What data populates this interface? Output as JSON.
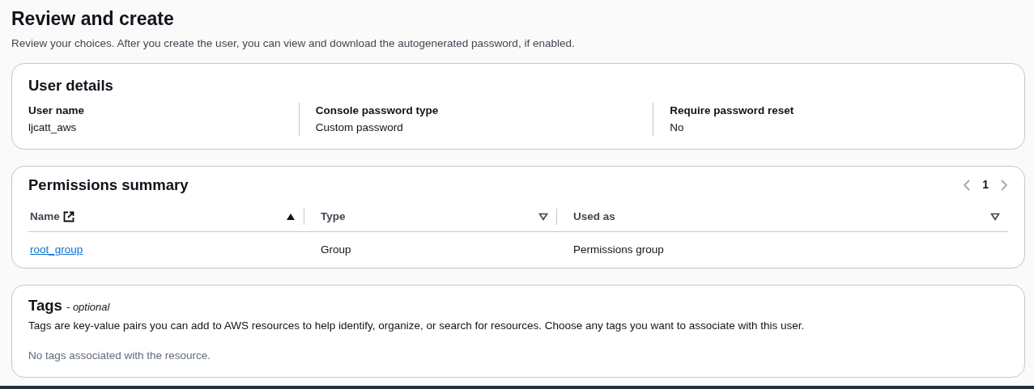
{
  "page": {
    "title": "Review and create",
    "description": "Review your choices. After you create the user, you can view and download the autogenerated password, if enabled."
  },
  "user_details": {
    "title": "User details",
    "fields": [
      {
        "label": "User name",
        "value": "ljcatt_aws"
      },
      {
        "label": "Console password type",
        "value": "Custom password"
      },
      {
        "label": "Require password reset",
        "value": "No"
      }
    ]
  },
  "permissions_summary": {
    "title": "Permissions summary",
    "pagination": {
      "current_page": "1",
      "prev_disabled": true,
      "next_disabled": true
    },
    "table": {
      "columns": [
        {
          "label": "Name",
          "external_link": true,
          "sorted": true
        },
        {
          "label": "Type",
          "external_link": false,
          "sorted": false
        },
        {
          "label": "Used as",
          "external_link": false,
          "sorted": false
        }
      ],
      "rows": [
        {
          "cells": [
            "root_group",
            "Group",
            "Permissions group"
          ]
        }
      ]
    }
  },
  "tags": {
    "title": "Tags",
    "title_suffix": "- optional",
    "description": "Tags are key-value pairs you can add to AWS resources to help identify, organize, or search for resources. Choose any tags you want to associate with this user.",
    "empty_message": "No tags associated with the resource."
  }
}
